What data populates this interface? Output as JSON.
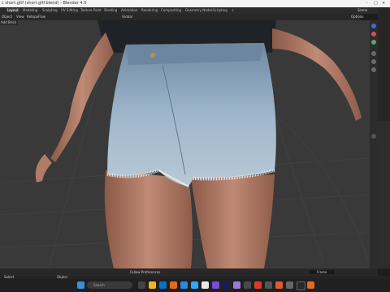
{
  "window": {
    "title": "c short.gltf (short.gltf.blend) - Blender 4.0"
  },
  "workspace_tabs": [
    "Layout",
    "Modeling",
    "Sculpting",
    "UV Editing",
    "Texture Paint",
    "Shading",
    "Animation",
    "Rendering",
    "Compositing",
    "Geometry Nodes",
    "Scripting"
  ],
  "scene_label": "Scene",
  "header": {
    "mode": "Object",
    "object_menu": "Object",
    "view": "View",
    "select": "Select",
    "add": "Add",
    "retopo": "RetopoFlow",
    "transform": "Global",
    "options": "Options"
  },
  "viewport": {
    "corner_label": "Add Brick"
  },
  "bottom": {
    "follow_label": "Follow Preferences",
    "search_placeholder": "Frame"
  },
  "status": {
    "select": "Select",
    "object": "Object"
  },
  "taskbar": {
    "search_placeholder": "Search"
  },
  "colors": {
    "viewport": "#393939",
    "panel": "#262626",
    "accent": "#4772b3"
  }
}
